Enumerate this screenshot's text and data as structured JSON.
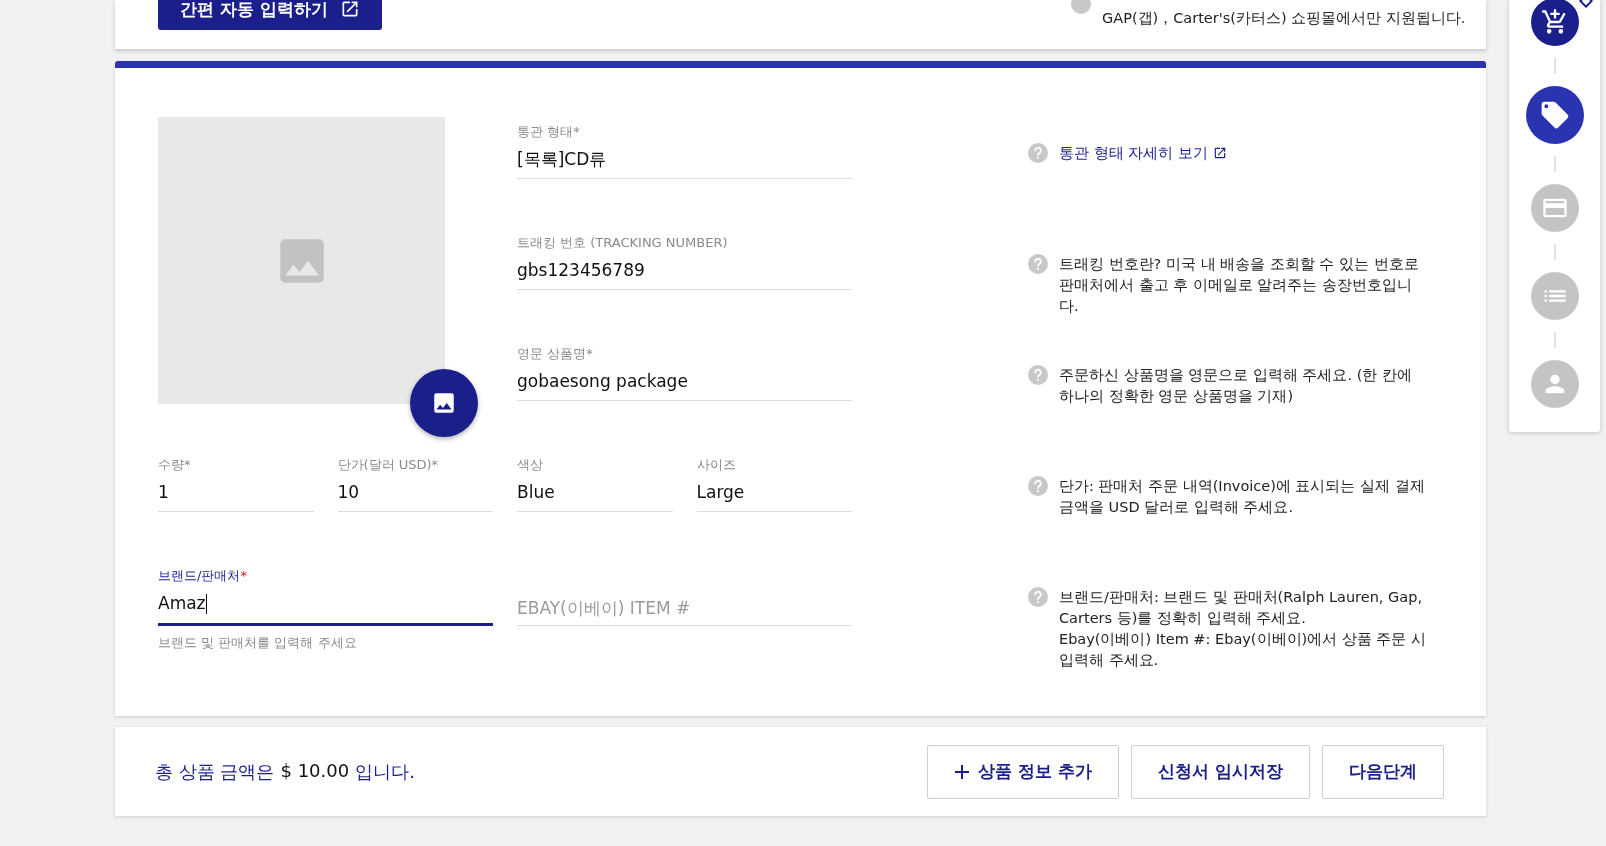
{
  "top_card": {
    "auto_fill_button": "간편 자동 입력하기",
    "help": "GAP(갭)，Carter's(카터스) 쇼핑몰에서만 지원됩니다."
  },
  "product_form": {
    "main_fields": [
      {
        "label": "통관 형태",
        "required_mark": "*",
        "value": "[목록]CD류",
        "focused": false
      },
      {
        "label": "트래킹 번호 (TRACKING NUMBER)",
        "value": "gbs123456789",
        "focused": false
      },
      {
        "label": "영문 상품명",
        "required_mark": "*",
        "value": "gobaesong package",
        "focused": false
      }
    ],
    "detail_fields": [
      {
        "label": "수량",
        "required_mark": "*",
        "value": "1",
        "focused": false
      },
      {
        "label": "단가(달러 USD)",
        "required_mark": "*",
        "value": "10",
        "focused": false
      },
      {
        "label": "색상",
        "value": "Blue",
        "focused": false
      },
      {
        "label": "사이즈",
        "value": "Large",
        "focused": false
      }
    ],
    "brand_field": {
      "label": "브랜드/판매처",
      "required_mark": "*",
      "value": "Amaz",
      "focused": true,
      "helper": "브랜드 및 판매처를 입력해 주세요"
    },
    "ebay_field": {
      "placeholder": "EBAY(이베이) ITEM #",
      "focused": false
    },
    "help": [
      {
        "kind": "link",
        "text": "통관 형태 자세히 보기"
      },
      {
        "kind": "text",
        "text": "트래킹 번호란? 미국 내 배송을 조회할 수 있는 번호로 판매처에서 출고 후 이메일로 알려주는 송장번호입니다."
      },
      {
        "kind": "text",
        "text": "주문하신 상품명을 영문으로 입력해 주세요. (한 칸에 하나의 정확한 영문 상품명을 기재)"
      },
      {
        "kind": "text",
        "text": "단가: 판매처 주문 내역(Invoice)에 표시되는 실제 결제 금액을 USD 달러로 입력해 주세요."
      },
      {
        "kind": "text",
        "text": "브랜드/판매처: 브랜드 및 판매처(Ralph Lauren, Gap, Carters 등)를 정확히 입력해 주세요.\nEbay(이베이) Item #: Ebay(이베이)에서 상품 주문 시 입력해 주세요."
      }
    ]
  },
  "summary": {
    "total_prefix": "총 상품 금액은",
    "total_amount": "$ 10.00",
    "total_suffix": "입니다.",
    "buttons": [
      {
        "kind": "add",
        "label": "상품 정보 추가"
      },
      {
        "kind": "plain",
        "label": "신청서 임시저장"
      },
      {
        "kind": "plain",
        "label": "다음단계"
      }
    ]
  },
  "stepper": [
    {
      "kind": "cart",
      "completed": true,
      "selected": false
    },
    {
      "kind": "tag",
      "completed": false,
      "selected": true
    },
    {
      "kind": "card",
      "completed": false,
      "selected": false
    },
    {
      "kind": "list",
      "completed": false,
      "selected": false
    },
    {
      "kind": "person",
      "completed": false,
      "selected": false
    }
  ]
}
